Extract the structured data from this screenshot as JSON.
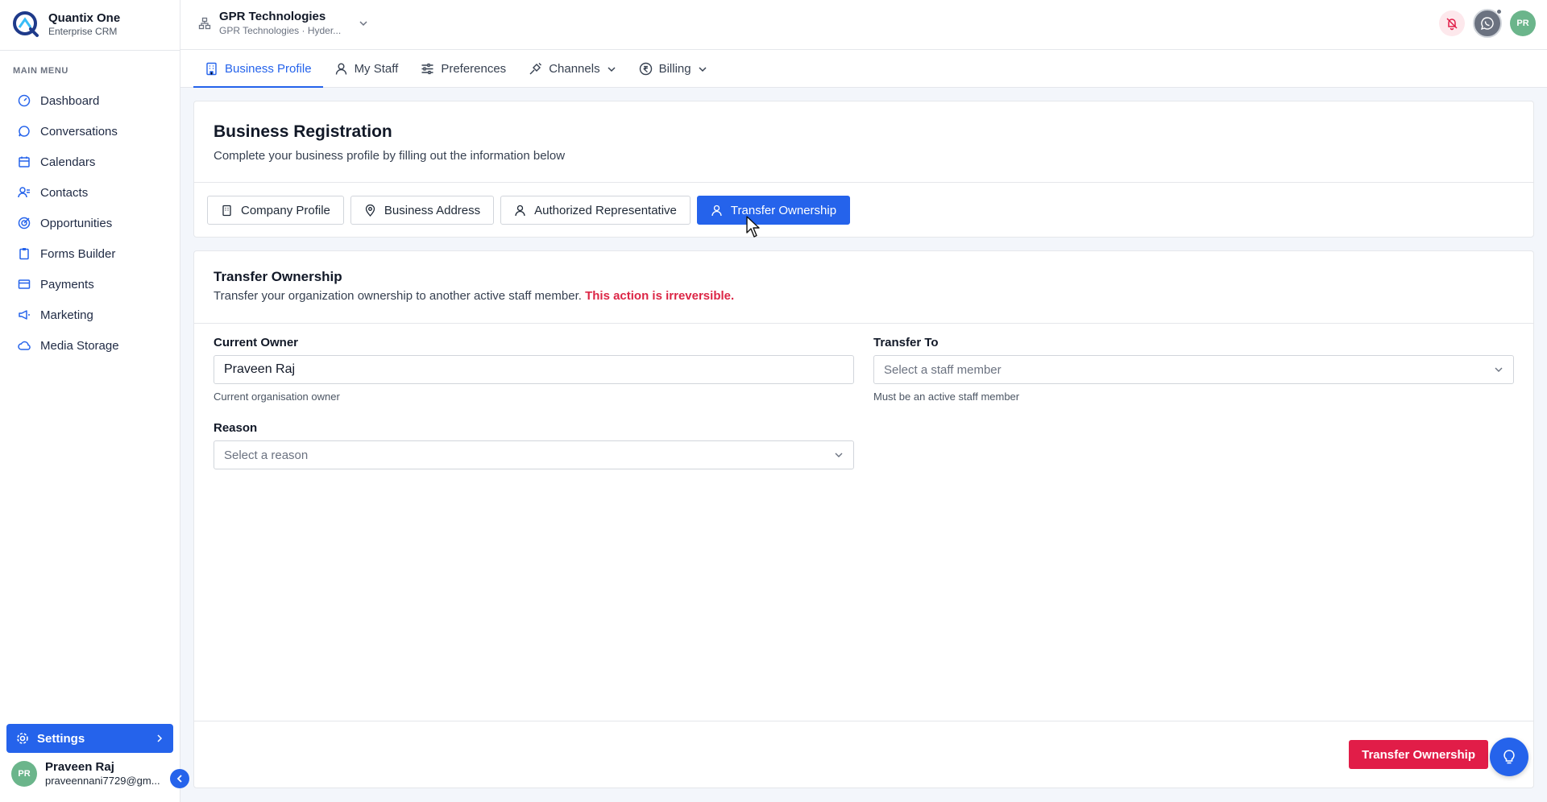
{
  "brand": {
    "name": "Quantix One",
    "subtitle": "Enterprise CRM"
  },
  "sidebar": {
    "menu_title": "MAIN MENU",
    "items": [
      {
        "label": "Dashboard",
        "icon": "dashboard-icon"
      },
      {
        "label": "Conversations",
        "icon": "chat-icon"
      },
      {
        "label": "Calendars",
        "icon": "calendar-icon"
      },
      {
        "label": "Contacts",
        "icon": "contacts-icon"
      },
      {
        "label": "Opportunities",
        "icon": "target-icon"
      },
      {
        "label": "Forms Builder",
        "icon": "clipboard-icon"
      },
      {
        "label": "Payments",
        "icon": "card-icon"
      },
      {
        "label": "Marketing",
        "icon": "megaphone-icon"
      },
      {
        "label": "Media Storage",
        "icon": "cloud-icon"
      }
    ],
    "settings_label": "Settings",
    "user": {
      "initials": "PR",
      "name": "Praveen Raj",
      "email": "praveennani7729@gm..."
    }
  },
  "header": {
    "org_name": "GPR Technologies",
    "org_sub": "GPR Technologies · Hyder...",
    "user_initials": "PR"
  },
  "tabs": [
    {
      "label": "Business Profile",
      "active": true
    },
    {
      "label": "My Staff"
    },
    {
      "label": "Preferences"
    },
    {
      "label": "Channels"
    },
    {
      "label": "Billing"
    }
  ],
  "registration": {
    "title": "Business Registration",
    "subtitle": "Complete your business profile by filling out the information below",
    "subtabs": [
      {
        "label": "Company Profile"
      },
      {
        "label": "Business Address"
      },
      {
        "label": "Authorized Representative"
      },
      {
        "label": "Transfer Ownership",
        "active": true
      }
    ]
  },
  "transfer": {
    "title": "Transfer Ownership",
    "subtitle": "Transfer your organization ownership to another active staff member. ",
    "warning": "This action is irreversible.",
    "current_owner_label": "Current Owner",
    "current_owner_value": "Praveen Raj",
    "current_owner_hint": "Current organisation owner",
    "transfer_to_label": "Transfer To",
    "transfer_to_placeholder": "Select a staff member",
    "transfer_to_hint": "Must be an active staff member",
    "reason_label": "Reason",
    "reason_placeholder": "Select a reason",
    "submit_label": "Transfer Ownership"
  },
  "colors": {
    "primary": "#2563eb",
    "danger": "#e11d48"
  }
}
